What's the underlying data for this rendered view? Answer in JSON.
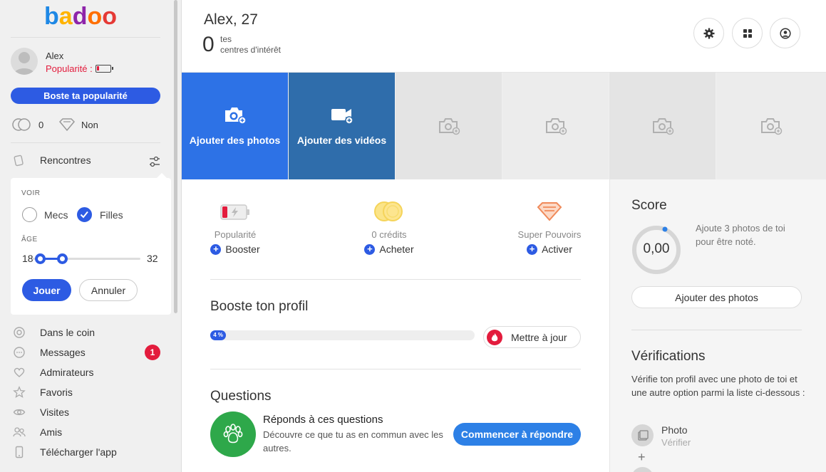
{
  "brand": {
    "logo_text": "badoo"
  },
  "sidebar": {
    "user": {
      "name": "Alex",
      "popularity_label": "Popularité :",
      "popularity_level": 0.15
    },
    "boost_label": "Boste ta popularité",
    "credits_count": "0",
    "super_powers": "Non",
    "encounters_label": "Rencontres",
    "filter": {
      "show_label": "VOIR",
      "option_men": "Mecs",
      "option_women": "Filles",
      "women_checked": true,
      "age_label": "ÂGE",
      "age_min": "18",
      "age_max": "32",
      "play_label": "Jouer",
      "cancel_label": "Annuler"
    },
    "nav": [
      {
        "label": "Dans le coin"
      },
      {
        "label": "Messages",
        "badge": "1"
      },
      {
        "label": "Admirateurs"
      },
      {
        "label": "Favoris"
      },
      {
        "label": "Visites"
      },
      {
        "label": "Amis"
      },
      {
        "label": "Télécharger l'app"
      }
    ]
  },
  "header": {
    "title": "Alex, 27",
    "interests_count": "0",
    "interests_line1": "tes",
    "interests_line2": "centres d'intérêt"
  },
  "media": {
    "add_photos": "Ajouter des photos",
    "add_videos": "Ajouter des vidéos"
  },
  "stats": [
    {
      "label": "Popularité",
      "action": "Booster"
    },
    {
      "label": "0 crédits",
      "action": "Acheter"
    },
    {
      "label": "Super Pouvoirs",
      "action": "Activer"
    }
  ],
  "boost_profile": {
    "title": "Booste ton profil",
    "progress_text": "4 %",
    "progress_value": 4,
    "update_label": "Mettre à jour"
  },
  "questions": {
    "title": "Questions",
    "card_title": "Réponds à ces questions",
    "card_desc": "Découvre ce que tu as en commun avec les autres.",
    "button": "Commencer à répondre"
  },
  "score": {
    "title": "Score",
    "value": "0,00",
    "hint": "Ajoute 3 photos de toi pour être noté.",
    "button": "Ajouter des photos"
  },
  "verifications": {
    "title": "Vérifications",
    "desc": "Vérifie ton profil avec une photo de toi et une autre option parmi la liste ci-dessous :",
    "item_name": "Photo",
    "item_action": "Vérifier",
    "plus": "+"
  },
  "colors": {
    "accent": "#2d5be3",
    "alert": "#e31c3d",
    "photo_tile": "#2d72e6",
    "video_tile": "#2f6dab",
    "questions_green": "#2ea84a"
  }
}
